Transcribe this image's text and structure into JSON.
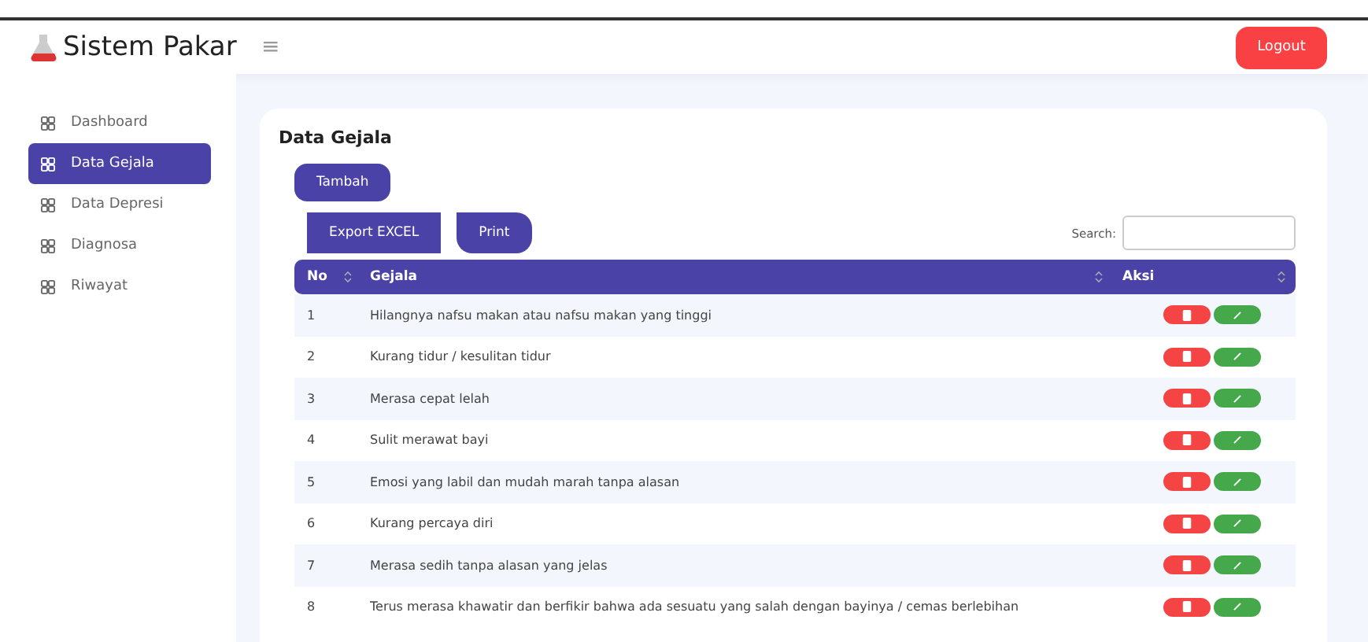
{
  "brand": {
    "title": "Sistem Pakar"
  },
  "header": {
    "menu_glyph": "≡",
    "logout": "Logout"
  },
  "sidebar": {
    "items": [
      {
        "label": "Dashboard",
        "selected": false
      },
      {
        "label": "Data Gejala",
        "selected": true
      },
      {
        "label": "Data Depresi",
        "selected": false
      },
      {
        "label": "Diagnosa",
        "selected": false
      },
      {
        "label": "Riwayat",
        "selected": false
      }
    ]
  },
  "card": {
    "title": "Data Gejala",
    "add_button": "Tambah",
    "export_buttons": [
      "Export EXCEL",
      "Print"
    ],
    "search_label": "Search:"
  },
  "table": {
    "columns": [
      "No",
      "Gejala",
      "Aksi"
    ],
    "rows": [
      {
        "no": "1",
        "gejala": "Hilangnya nafsu makan atau nafsu makan yang tinggi"
      },
      {
        "no": "2",
        "gejala": "Kurang tidur / kesulitan tidur"
      },
      {
        "no": "3",
        "gejala": "Merasa cepat lelah"
      },
      {
        "no": "4",
        "gejala": "Sulit merawat bayi"
      },
      {
        "no": "5",
        "gejala": "Emosi yang labil dan mudah marah tanpa alasan"
      },
      {
        "no": "6",
        "gejala": "Kurang percaya diri"
      },
      {
        "no": "7",
        "gejala": "Merasa sedih tanpa alasan yang jelas"
      },
      {
        "no": "8",
        "gejala": "Terus merasa khawatir dan berfikir bahwa ada sesuatu yang salah dengan bayinya / cemas berlebihan"
      }
    ]
  }
}
